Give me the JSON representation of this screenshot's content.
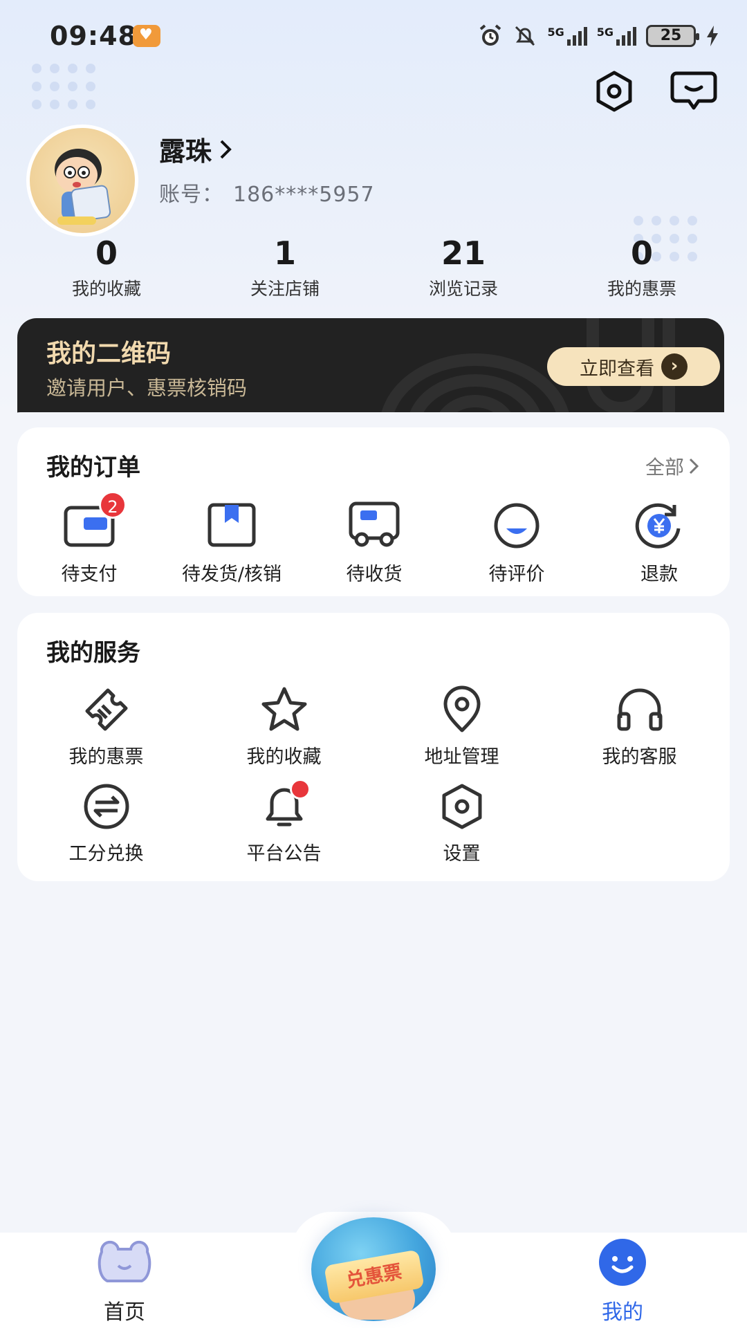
{
  "status_bar": {
    "time": "09:48",
    "network_1": "5G",
    "network_2": "5G",
    "battery": "25"
  },
  "profile": {
    "name": "露珠",
    "account_label": "账号：",
    "account_value": "186****5957"
  },
  "stats": [
    {
      "value": "0",
      "label": "我的收藏"
    },
    {
      "value": "1",
      "label": "关注店铺"
    },
    {
      "value": "21",
      "label": "浏览记录"
    },
    {
      "value": "0",
      "label": "我的惠票"
    }
  ],
  "qr_banner": {
    "title": "我的二维码",
    "subtitle": "邀请用户、惠票核销码",
    "button": "立即查看"
  },
  "orders": {
    "title": "我的订单",
    "more": "全部",
    "items": [
      {
        "label": "待支付",
        "icon": "wallet-icon",
        "badge": "2"
      },
      {
        "label": "待发货/核销",
        "icon": "bookmark-box-icon"
      },
      {
        "label": "待收货",
        "icon": "truck-icon"
      },
      {
        "label": "待评价",
        "icon": "smile-comment-icon"
      },
      {
        "label": "退款",
        "icon": "refund-yen-icon"
      }
    ]
  },
  "services": {
    "title": "我的服务",
    "items": [
      {
        "label": "我的惠票",
        "icon": "ticket-icon"
      },
      {
        "label": "我的收藏",
        "icon": "star-icon"
      },
      {
        "label": "地址管理",
        "icon": "location-pin-icon"
      },
      {
        "label": "我的客服",
        "icon": "headset-icon"
      },
      {
        "label": "工分兑换",
        "icon": "exchange-icon"
      },
      {
        "label": "平台公告",
        "icon": "bell-icon"
      },
      {
        "label": "设置",
        "icon": "settings-hex-icon"
      }
    ]
  },
  "tabbar": {
    "home": "首页",
    "center": "兑惠票",
    "mine": "我的"
  },
  "colors": {
    "accent": "#3068e8",
    "badge_red": "#e8363b",
    "banner_bg": "#222222",
    "banner_text": "#f1d9ae"
  }
}
